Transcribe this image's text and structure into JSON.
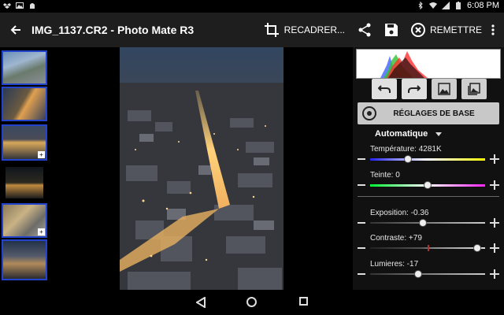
{
  "status_bar": {
    "time": "6:08 PM",
    "left_icons": [
      "dropbox-icon",
      "image-icon",
      "android-icon"
    ],
    "right_icons": [
      "bluetooth-icon",
      "wifi-icon",
      "signal-icon",
      "battery-icon"
    ]
  },
  "toolbar": {
    "back_icon": "arrow-left-icon",
    "title": "IMG_1137.CR2 - Photo Mate R3",
    "crop_label": "RECADRER...",
    "share_icon": "share-icon",
    "save_icon": "save-icon",
    "reset_label": "REMETTRE",
    "overflow_icon": "more-vert-icon"
  },
  "filmstrip": {
    "items": [
      {
        "selected": true,
        "badge": ""
      },
      {
        "selected": true,
        "badge": ""
      },
      {
        "selected": true,
        "badge": "+"
      },
      {
        "selected": false,
        "badge": ""
      },
      {
        "selected": true,
        "badge": "+"
      },
      {
        "selected": true,
        "badge": ""
      }
    ]
  },
  "panel": {
    "tools": [
      "undo-icon",
      "redo-icon",
      "image-icon",
      "compare-image-icon"
    ],
    "preset_label": "RÉGLAGES DE BASE",
    "mode_label": "Automatique",
    "sliders": [
      {
        "id": "temperature",
        "label": "Température: 4281K",
        "value": 0.33
      },
      {
        "id": "tint",
        "label": "Teinte: 0",
        "value": 0.5
      },
      {
        "id": "exposure",
        "label": "Exposition: -0.36",
        "value": 0.46
      },
      {
        "id": "contrast",
        "label": "Contraste: +79",
        "value": 0.93
      },
      {
        "id": "lights",
        "label": "Lumieres: -17",
        "value": 0.42
      }
    ]
  },
  "colors": {
    "selection_border": "#2244cc",
    "toolbar_bg": "#1e1e1e",
    "panel_bg": "#111111"
  }
}
